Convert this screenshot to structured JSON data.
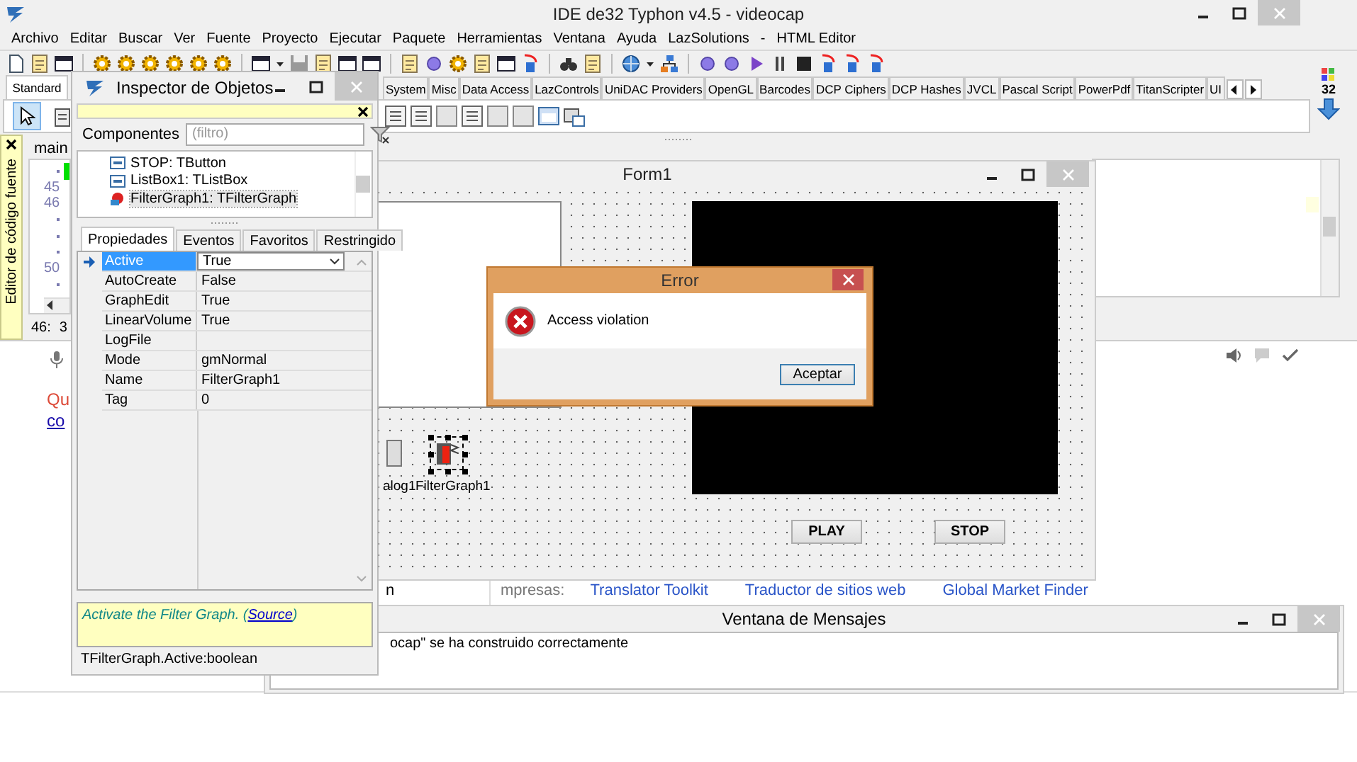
{
  "main_window": {
    "title": "IDE de32 Typhon v4.5 - videocap",
    "menu": [
      "Archivo",
      "Editar",
      "Buscar",
      "Ver",
      "Fuente",
      "Proyecto",
      "Ejecutar",
      "Paquete",
      "Herramientas",
      "Ventana",
      "Ayuda",
      "LazSolutions",
      "-",
      "HTML Editor"
    ],
    "palette_tabs": [
      {
        "label": "Standard",
        "selected": true
      },
      {
        "label": "System",
        "selected": false
      },
      {
        "label": "Misc",
        "selected": false
      },
      {
        "label": "Data Access",
        "selected": false
      },
      {
        "label": "LazControls",
        "selected": false
      },
      {
        "label": "UniDAC Providers",
        "selected": false
      },
      {
        "label": "OpenGL",
        "selected": false
      },
      {
        "label": "Barcodes",
        "selected": false
      },
      {
        "label": "DCP Ciphers",
        "selected": false
      },
      {
        "label": "DCP Hashes",
        "selected": false
      },
      {
        "label": "JVCL",
        "selected": false
      },
      {
        "label": "Pascal Script",
        "selected": false
      },
      {
        "label": "PowerPdf",
        "selected": false
      },
      {
        "label": "TitanScripter",
        "selected": false
      },
      {
        "label": "UI",
        "selected": false
      }
    ],
    "palette_badge": "32"
  },
  "source_editor": {
    "side_label": "Editor de código fuente",
    "tab": "main",
    "gutter": [
      {
        "kind": "dot"
      },
      {
        "kind": "number",
        "label": "45"
      },
      {
        "kind": "number",
        "label": "46"
      },
      {
        "kind": "dot"
      },
      {
        "kind": "dot"
      },
      {
        "kind": "dot"
      },
      {
        "kind": "number",
        "label": "50"
      },
      {
        "kind": "dot"
      }
    ],
    "status_line": "46:",
    "status_col": "3"
  },
  "background_page": {
    "text": "Qu",
    "link": "co",
    "footer_label": "mpresas:",
    "footer_links": [
      "Translator Toolkit",
      "Traductor de sitios web",
      "Global Market Finder"
    ],
    "fragment": "n"
  },
  "object_inspector": {
    "title": "Inspector de Objetos",
    "filter_label": "Componentes",
    "filter_placeholder": "(filtro)",
    "components": [
      {
        "label": "STOP: TButton",
        "selected": false
      },
      {
        "label": "ListBox1: TListBox",
        "selected": false
      },
      {
        "label": "FilterGraph1: TFilterGraph",
        "selected": true
      }
    ],
    "tabs": [
      {
        "label": "Propiedades",
        "selected": true
      },
      {
        "label": "Eventos",
        "selected": false
      },
      {
        "label": "Favoritos",
        "selected": false
      },
      {
        "label": "Restringido",
        "selected": false
      }
    ],
    "properties": [
      {
        "name": "Active",
        "value": "True",
        "selected": true
      },
      {
        "name": "AutoCreate",
        "value": "False",
        "selected": false
      },
      {
        "name": "GraphEdit",
        "value": "True",
        "selected": false
      },
      {
        "name": "LinearVolume",
        "value": "True",
        "selected": false
      },
      {
        "name": "LogFile",
        "selected": false
      },
      {
        "name": "Mode",
        "value": "gmNormal",
        "selected": false
      },
      {
        "name": "Name",
        "value": "FilterGraph1",
        "selected": false
      },
      {
        "name": "Tag",
        "value": "0",
        "selected": false
      }
    ],
    "hint": {
      "before": "Activate the Filter Graph. (",
      "link": "Source",
      "after": ")"
    },
    "type_info": "TFilterGraph.Active:boolean"
  },
  "form_designer": {
    "title": "Form1",
    "component_labels": [
      "alog1",
      "FilterGraph1"
    ],
    "buttons": [
      "PLAY",
      "STOP"
    ]
  },
  "error_dialog": {
    "title": "Error",
    "message": "Access violation",
    "button": "Aceptar"
  },
  "messages_window": {
    "title": "Ventana de Mensajes",
    "message": "ocap\" se ha construido correctamente"
  }
}
